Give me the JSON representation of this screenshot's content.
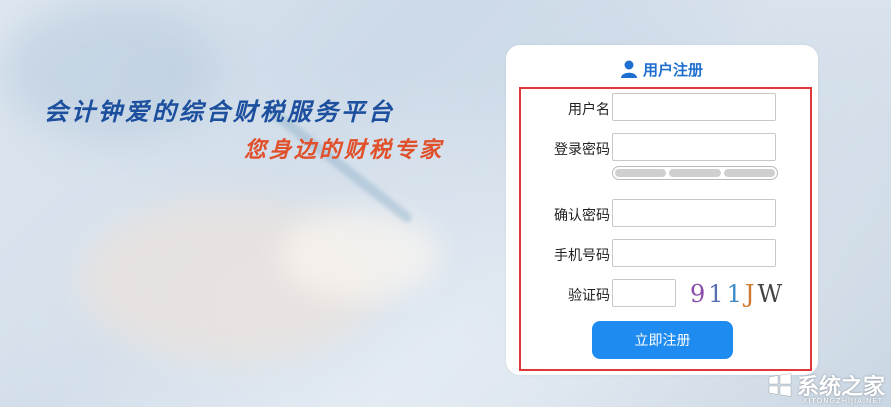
{
  "slogan": {
    "line1": "会计钟爱的综合财税服务平台",
    "line2": "您身边的财税专家"
  },
  "form": {
    "title": "用户注册",
    "title_icon": "user-icon",
    "fields": {
      "username": {
        "label": "用户名",
        "value": ""
      },
      "password": {
        "label": "登录密码",
        "value": ""
      },
      "confirm": {
        "label": "确认密码",
        "value": ""
      },
      "phone": {
        "label": "手机号码",
        "value": ""
      },
      "captcha": {
        "label": "验证码",
        "value": ""
      }
    },
    "colon": "：",
    "captcha_image": {
      "c1": "9",
      "c2": "1",
      "c3": "1",
      "c4": "J",
      "c5": "W"
    },
    "submit_label": "立即注册"
  },
  "watermark": {
    "text": "系统之家",
    "sub": "XITONGZHIJIA.NET"
  },
  "colors": {
    "accent": "#1e8bf0",
    "title": "#1f6fd0",
    "highlight_box": "#e03838",
    "slogan1": "#1c4f9e",
    "slogan2": "#e0502a"
  }
}
